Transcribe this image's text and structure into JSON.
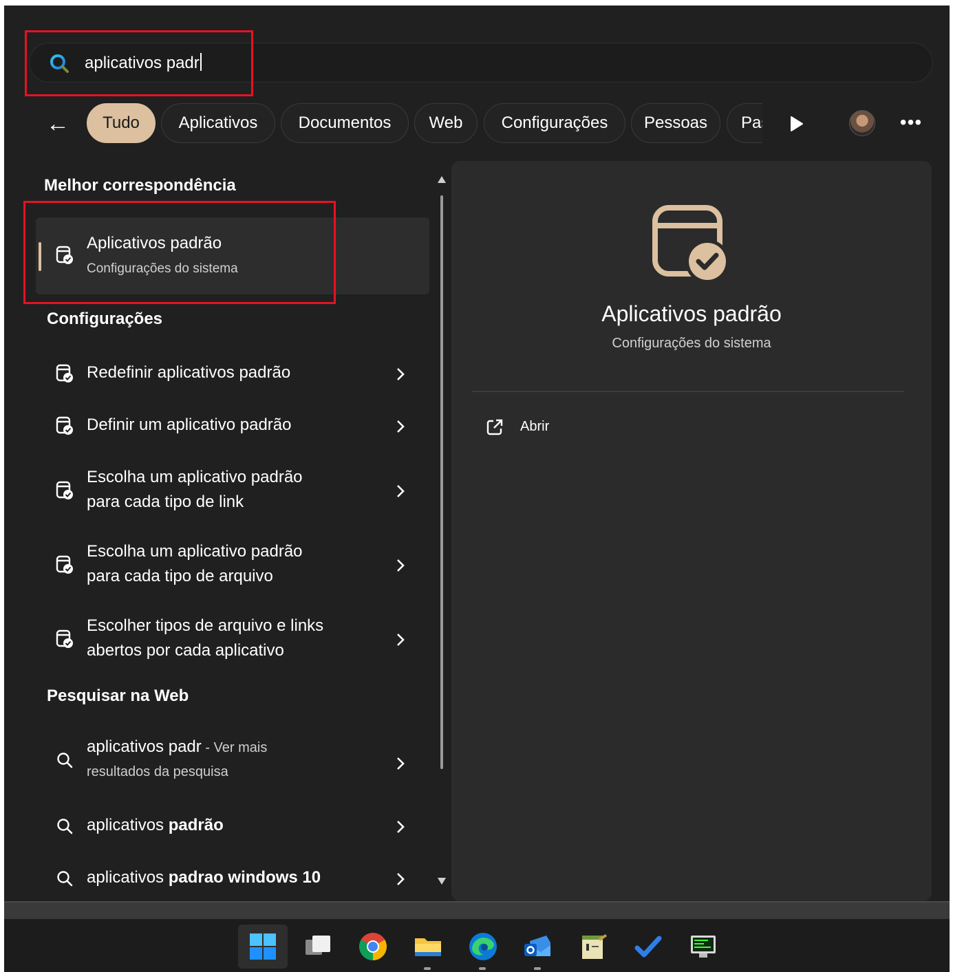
{
  "search": {
    "query": "aplicativos padr"
  },
  "tabs": [
    {
      "label": "Tudo",
      "active": true
    },
    {
      "label": "Aplicativos",
      "active": false
    },
    {
      "label": "Documentos",
      "active": false
    },
    {
      "label": "Web",
      "active": false
    },
    {
      "label": "Configurações",
      "active": false
    },
    {
      "label": "Pessoas",
      "active": false
    },
    {
      "label": "Pas",
      "active": false
    }
  ],
  "icons": {
    "back": "back-arrow-icon",
    "search": "search-icon",
    "more": "more-icon",
    "play": "play-icon",
    "settings_app": "default-apps-icon",
    "chevron": "chevron-right-icon",
    "open": "open-external-icon"
  },
  "colors": {
    "accent": "#dcc0a0",
    "highlight": "#e81123"
  },
  "best_match": {
    "section_title": "Melhor correspondência",
    "title": "Aplicativos padrão",
    "subtitle": "Configurações do sistema"
  },
  "settings": {
    "section_title": "Configurações",
    "items": [
      {
        "line1": "Redefinir aplicativos padrão",
        "line2": ""
      },
      {
        "line1": "Definir um aplicativo padrão",
        "line2": ""
      },
      {
        "line1": "Escolha um aplicativo padrão",
        "line2": "para cada tipo de link"
      },
      {
        "line1": "Escolha um aplicativo padrão",
        "line2": "para cada tipo de arquivo"
      },
      {
        "line1": "Escolher tipos de arquivo e links",
        "line2": "abertos por cada aplicativo"
      }
    ]
  },
  "web": {
    "section_title": "Pesquisar na Web",
    "first": {
      "query": "aplicativos padr",
      "suffix": " - Ver mais",
      "line2": "resultados da pesquisa"
    },
    "second": {
      "prefix": "aplicativos ",
      "bold": "padrão"
    },
    "third": {
      "prefix": "aplicativos ",
      "bold": "padrao windows 10"
    }
  },
  "preview": {
    "title": "Aplicativos padrão",
    "subtitle": "Configurações do sistema",
    "open_label": "Abrir"
  },
  "taskbar": {
    "items": [
      "start",
      "task-view",
      "chrome",
      "file-explorer",
      "edge",
      "outlook",
      "notepad",
      "todo",
      "terminal"
    ]
  }
}
